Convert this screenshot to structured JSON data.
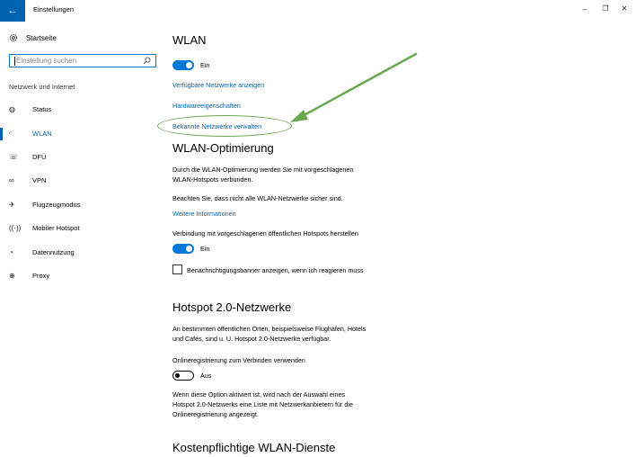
{
  "titlebar": {
    "app_title": "Einstellungen",
    "back_icon": "←",
    "min_icon": "–",
    "max_icon": "❐",
    "close_icon": "✕"
  },
  "sidebar": {
    "home_label": "Startseite",
    "search_placeholder": "Einstellung suchen",
    "section_title": "Netzwerk und Internet",
    "items": [
      {
        "label": "Status",
        "icon": "globe-icon"
      },
      {
        "label": "WLAN",
        "icon": "wifi-icon"
      },
      {
        "label": "DFÜ",
        "icon": "dialup-icon"
      },
      {
        "label": "VPN",
        "icon": "vpn-icon"
      },
      {
        "label": "Flugzeugmodus",
        "icon": "airplane-icon"
      },
      {
        "label": "Mobiler Hotspot",
        "icon": "hotspot-icon"
      },
      {
        "label": "Datennutzung",
        "icon": "data-usage-icon"
      },
      {
        "label": "Proxy",
        "icon": "proxy-globe-icon"
      }
    ],
    "active_item": "WLAN"
  },
  "main": {
    "title": "WLAN",
    "wlan_toggle_label": "Ein",
    "link_available": "Verfügbare Netzwerke anzeigen",
    "link_hardware": "Hardwareeigenschaften",
    "link_known": "Bekannte Netzwerke verwalten",
    "opt_title": "WLAN-Optimierung",
    "opt_desc_1": "Durch die WLAN-Optimierung werden Sie mit vorgeschlagenen",
    "opt_desc_2": "WLAN-Hotspots verbunden.",
    "opt_note": "Beachten Sie, dass nicht alle WLAN-Netzwerke sicher sind.",
    "link_more": "Weitere Informationen",
    "connect_label": "Verbindung mit vorgeschlagenen öffentlichen Hotspots herstellen",
    "connect_toggle_label": "Ein",
    "banner_checkbox": "Benachrichtigungsbanner anzeigen, wenn ich reagieren muss",
    "hs_title": "Hotspot 2.0-Netzwerke",
    "hs_desc_1": "An bestimmten öffentlichen Orten, beispielsweise Flughäfen, Hotels",
    "hs_desc_2": "und Cafés, sind u. U. Hotspot 2.0-Netzwerke verfügbar.",
    "online_label": "Onlineregistrierung zum Verbinden verwenden",
    "online_toggle_label": "Aus",
    "online_desc_1": "Wenn diese Option aktiviert ist, wird nach der Auswahl eines",
    "online_desc_2": "Hotspot 2.0-Netzwerks eine Liste mit Netzwerkanbietern für die",
    "online_desc_3": "Onlineregistrierung angezeigt.",
    "paid_title": "Kostenpflichtige WLAN-Dienste"
  },
  "annotation": {
    "color": "#6aa84f"
  },
  "colors": {
    "accent": "#0078d7",
    "link": "#0063b1"
  }
}
